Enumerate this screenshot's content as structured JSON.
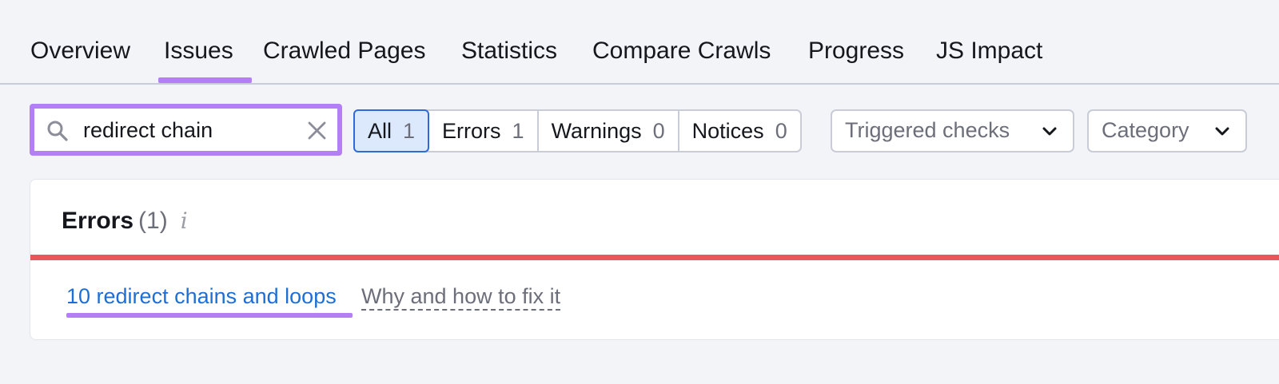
{
  "tabs": [
    {
      "label": "Overview"
    },
    {
      "label": "Issues",
      "active": true
    },
    {
      "label": "Crawled Pages"
    },
    {
      "label": "Statistics"
    },
    {
      "label": "Compare Crawls"
    },
    {
      "label": "Progress"
    },
    {
      "label": "JS Impact"
    }
  ],
  "search": {
    "value": "redirect chain"
  },
  "filters": [
    {
      "label": "All",
      "count": "1",
      "active": true
    },
    {
      "label": "Errors",
      "count": "1"
    },
    {
      "label": "Warnings",
      "count": "0"
    },
    {
      "label": "Notices",
      "count": "0"
    }
  ],
  "dropdowns": {
    "triggered_checks": "Triggered checks",
    "category": "Category"
  },
  "card": {
    "title": "Errors",
    "count": "(1)",
    "info_glyph": "i",
    "issue_link": "10 redirect chains and loops",
    "help_link": "Why and how to fix it"
  },
  "colors": {
    "highlight": "#b47ff5",
    "error_bar": "#e8575d",
    "link": "#1d6fd6",
    "active_filter_border": "#2e6bd8"
  }
}
